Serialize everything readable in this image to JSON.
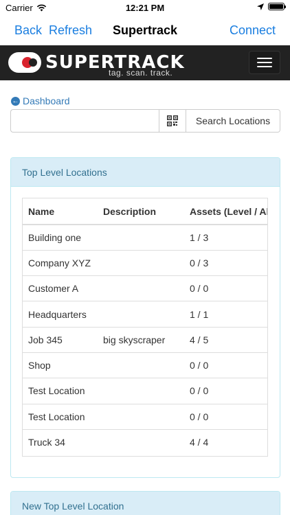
{
  "status_bar": {
    "carrier": "Carrier",
    "time": "12:21 PM"
  },
  "nav": {
    "back_label": "Back",
    "refresh_label": "Refresh",
    "title": "Supertrack",
    "connect_label": "Connect",
    "accent_color": "#1a7ee0"
  },
  "header": {
    "brand": "SUPERTRACK",
    "tagline": "tag.  scan.  track.",
    "menu_icon": "hamburger-icon"
  },
  "dashboard_link": {
    "label": "Dashboard",
    "icon": "arrow-left-circle-icon"
  },
  "search": {
    "value": "",
    "placeholder": "",
    "qr_icon": "qr-code-icon",
    "button_label": "Search Locations"
  },
  "top_locations": {
    "title": "Top Level Locations",
    "columns": [
      "Name",
      "Description",
      "Assets (Level / All)"
    ],
    "rows": [
      {
        "name": "Building one",
        "description": "",
        "assets": "1 / 3"
      },
      {
        "name": "Company XYZ",
        "description": "",
        "assets": "0 / 3"
      },
      {
        "name": "Customer A",
        "description": "",
        "assets": "0 / 0"
      },
      {
        "name": "Headquarters",
        "description": "",
        "assets": "1 / 1"
      },
      {
        "name": "Job 345",
        "description": "big skyscraper",
        "assets": "4 / 5"
      },
      {
        "name": "Shop",
        "description": "",
        "assets": "0 / 0"
      },
      {
        "name": "Test Location",
        "description": "",
        "assets": "0 / 0"
      },
      {
        "name": "Test Location",
        "description": "",
        "assets": "0 / 0"
      },
      {
        "name": "Truck 34",
        "description": "",
        "assets": "4 / 4"
      }
    ]
  },
  "new_location": {
    "title": "New Top Level Location"
  },
  "colors": {
    "header_bg": "#222222",
    "panel_heading_bg": "#d9edf7",
    "panel_heading_text": "#31708f",
    "link": "#337ab7",
    "logo_red": "#d9232d"
  }
}
